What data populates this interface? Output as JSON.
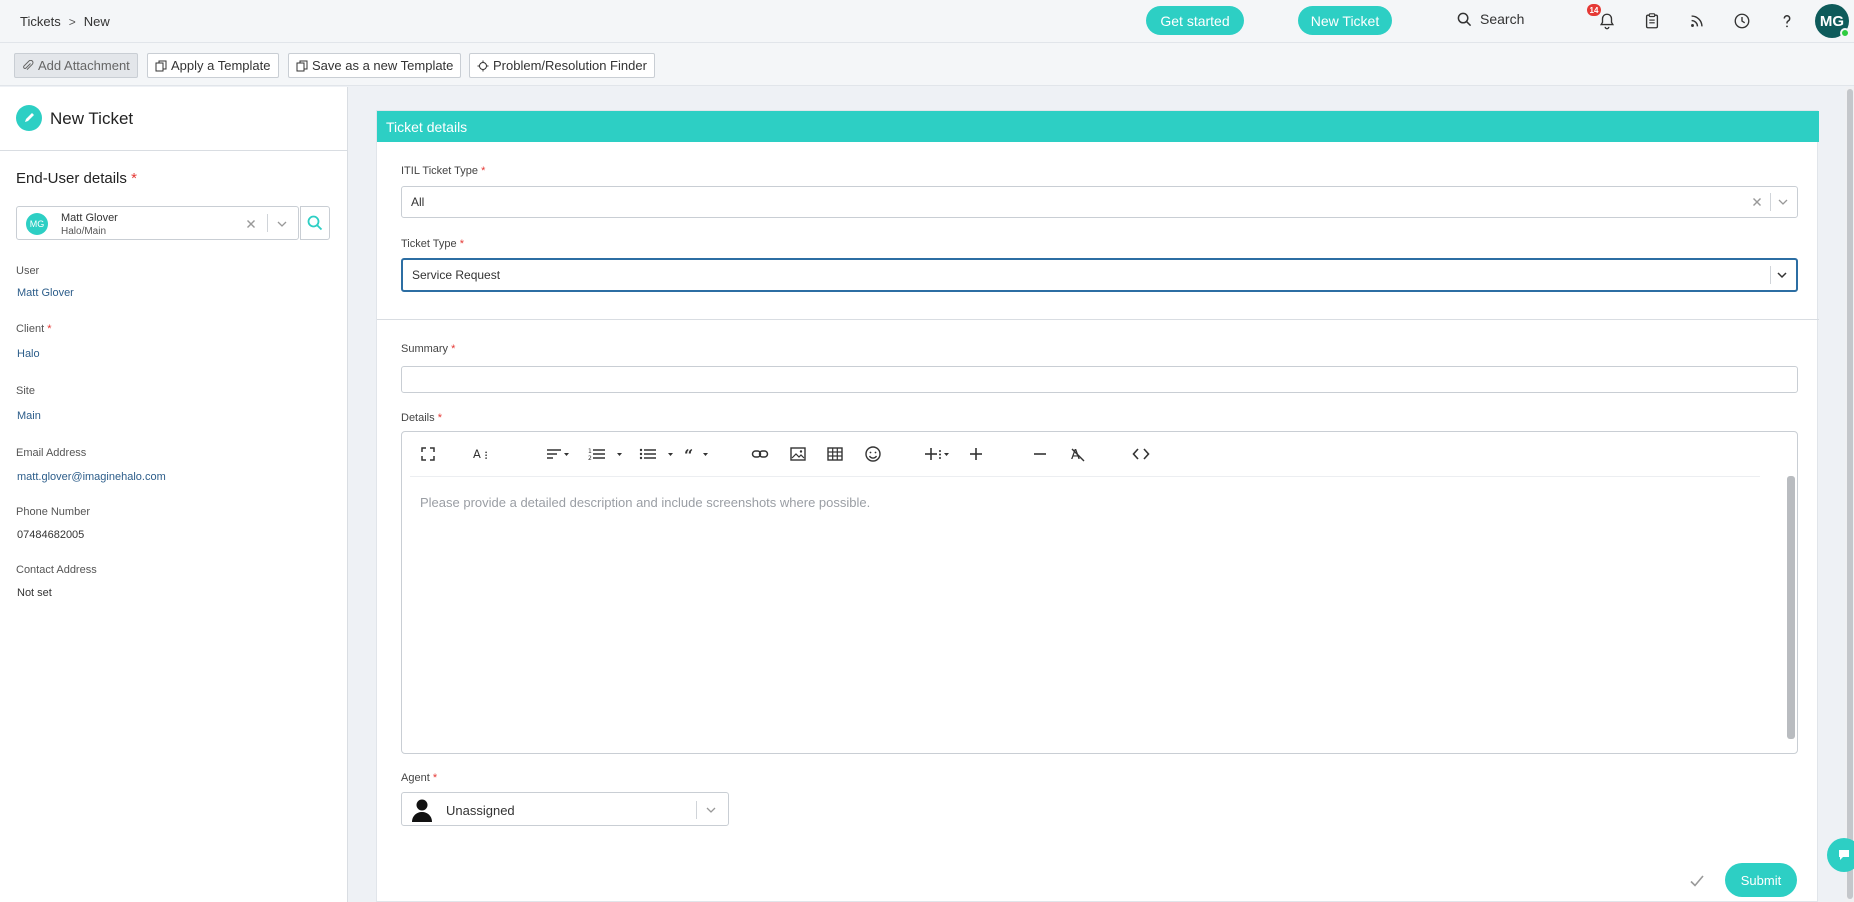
{
  "breadcrumb": {
    "root": "Tickets",
    "separator": ">",
    "current": "New"
  },
  "header": {
    "get_started": "Get started",
    "new_ticket": "New Ticket",
    "search_label": "Search",
    "notification_count": "14",
    "avatar_initials": "MG",
    "icons": [
      "bell-icon",
      "clipboard-icon",
      "rss-icon",
      "clock-icon",
      "help-icon"
    ]
  },
  "toolbar": {
    "add_attachment": "Add Attachment",
    "apply_template": "Apply a Template",
    "save_template": "Save as a new Template",
    "problem_finder": "Problem/Resolution Finder"
  },
  "left": {
    "title": "New Ticket",
    "section_title": "End-User details",
    "required_mark": "*",
    "selected_user": {
      "initials": "MG",
      "name": "Matt Glover",
      "sub": "Halo/Main"
    },
    "fields": [
      {
        "label": "User",
        "value": "Matt Glover",
        "required": false
      },
      {
        "label": "Client",
        "value": "Halo",
        "required": true
      },
      {
        "label": "Site",
        "value": "Main",
        "required": false
      },
      {
        "label": "Email Address",
        "value": "matt.glover@imaginehalo.com",
        "required": false
      },
      {
        "label": "Phone Number",
        "value": "07484682005",
        "required": false
      },
      {
        "label": "Contact Address",
        "value": "Not set",
        "required": false
      }
    ]
  },
  "main": {
    "card_title": "Ticket details",
    "itil_label": "ITIL Ticket Type",
    "itil_value": "All",
    "ticket_type_label": "Ticket Type",
    "ticket_type_value": "Service Request",
    "summary_label": "Summary",
    "summary_value": "",
    "details_label": "Details",
    "details_placeholder": "Please provide a detailed description and include screenshots where possible.",
    "agent_label": "Agent",
    "agent_value": "Unassigned",
    "submit_label": "Submit"
  },
  "colors": {
    "accent": "#2dcfc4",
    "required": "#e53935",
    "link": "#2c5d8a",
    "focus": "#2c6ea3"
  }
}
